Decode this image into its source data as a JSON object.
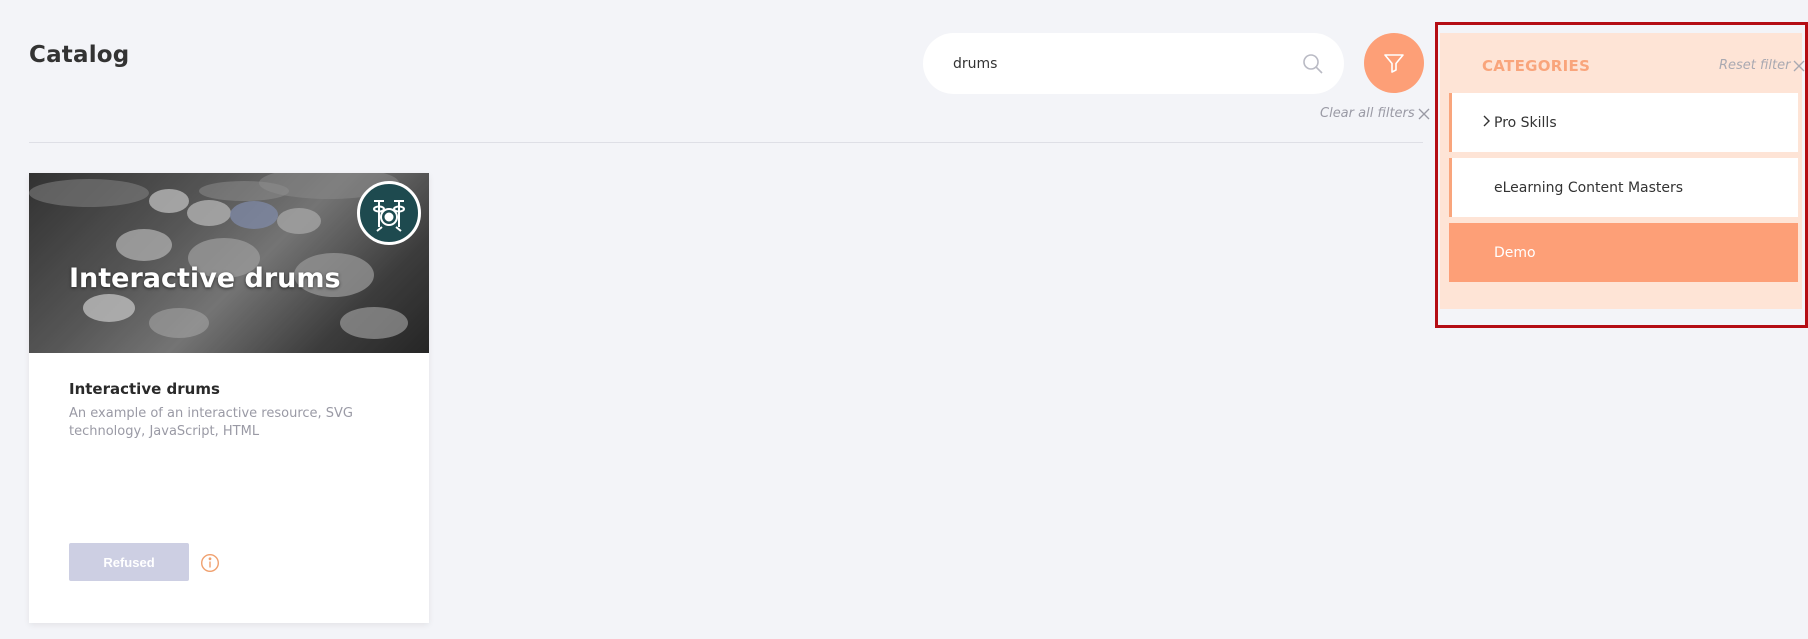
{
  "page": {
    "title": "Catalog"
  },
  "search": {
    "value": "drums",
    "placeholder": ""
  },
  "filters": {
    "clear_all_label": "Clear all filters"
  },
  "card": {
    "image_title": "Interactive drums",
    "title": "Interactive drums",
    "description": "An example of an interactive resource, SVG technology, JavaScript, HTML",
    "status_button": "Refused",
    "badge_icon": "drum-kit-icon"
  },
  "categories_panel": {
    "heading": "CATEGORIES",
    "reset_label": "Reset filter",
    "items": [
      {
        "label": "Pro Skills",
        "expandable": true,
        "active": false
      },
      {
        "label": "eLearning Content Masters",
        "expandable": false,
        "active": false
      },
      {
        "label": "Demo",
        "expandable": false,
        "active": true
      }
    ]
  },
  "colors": {
    "accent": "#fd9f77",
    "panel_bg": "#fee4d6",
    "highlight_border": "#b40d14",
    "page_bg": "#f3f4f8",
    "disabled_button": "#cdcfe3"
  }
}
